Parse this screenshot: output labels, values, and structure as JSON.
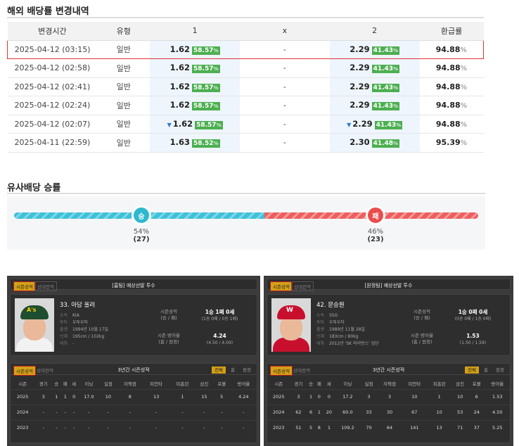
{
  "odds_section": {
    "title": "해외 배당률 변경내역",
    "headers": [
      "변경시간",
      "유형",
      "1",
      "x",
      "2",
      "환급률"
    ],
    "rows": [
      {
        "time": "2025-04-12 (03:15)",
        "type": "일반",
        "home": "1.62",
        "home_pct": "58.57",
        "draw": "-",
        "away": "2.29",
        "away_pct": "41.43",
        "return": "94.88",
        "selected": true,
        "home_down": false,
        "away_down": false
      },
      {
        "time": "2025-04-12 (02:58)",
        "type": "일반",
        "home": "1.62",
        "home_pct": "58.57",
        "draw": "-",
        "away": "2.29",
        "away_pct": "41.43",
        "return": "94.88",
        "selected": false,
        "home_down": false,
        "away_down": false
      },
      {
        "time": "2025-04-12 (02:41)",
        "type": "일반",
        "home": "1.62",
        "home_pct": "58.57",
        "draw": "-",
        "away": "2.29",
        "away_pct": "41.43",
        "return": "94.88",
        "selected": false,
        "home_down": false,
        "away_down": false
      },
      {
        "time": "2025-04-12 (02:24)",
        "type": "일반",
        "home": "1.62",
        "home_pct": "58.57",
        "draw": "-",
        "away": "2.29",
        "away_pct": "41.43",
        "return": "94.88",
        "selected": false,
        "home_down": false,
        "away_down": false
      },
      {
        "time": "2025-04-12 (02:07)",
        "type": "일반",
        "home": "1.62",
        "home_pct": "58.57",
        "draw": "-",
        "away": "2.29",
        "away_pct": "41.43",
        "return": "94.88",
        "selected": false,
        "home_down": true,
        "away_down": true
      },
      {
        "time": "2025-04-11 (22:59)",
        "type": "일반",
        "home": "1.63",
        "home_pct": "58.52",
        "draw": "-",
        "away": "2.30",
        "away_pct": "41.48",
        "return": "95.39",
        "selected": false,
        "home_down": false,
        "away_down": false
      }
    ],
    "pct_unit": "%",
    "return_unit": "%"
  },
  "similar_section": {
    "title": "유사배당 승률",
    "win_label": "승",
    "loss_label": "패",
    "win_pct": "54%",
    "win_count": "(27)",
    "loss_pct": "46%",
    "loss_count": "(23)",
    "win_fraction": 0.54,
    "colors": {
      "win": "#2db8cf",
      "loss": "#ea4d4d"
    }
  },
  "pitchers": [
    {
      "tab_active": "시즌성적",
      "tab_inactive": "상대전적",
      "header_title": "[홈팀] 예상선발 투수",
      "name": "33. 아담 올러",
      "info": [
        {
          "k": "소속",
          "v": "KIA"
        },
        {
          "k": "투타",
          "v": "우투우타"
        },
        {
          "k": "출생",
          "v": "1994년 10월 17일"
        },
        {
          "k": "신체",
          "v": "195cm / 102kg"
        },
        {
          "k": "데뷔",
          "v": "-"
        }
      ],
      "season_label_1": "시즌성적",
      "season_label_2": "(승 / 패)",
      "season_value": "1승 1패 0세",
      "season_sub": "(1승 0패 / 0승 1패)",
      "era_label_1": "시즌 방어율",
      "era_label_2": "(홈 / 원정)",
      "era_value": "4.24",
      "era_sub": "(4.50 / 4.09)",
      "stats_title": "3년간 시즌성적",
      "filters": [
        "전체",
        "홈",
        "원정"
      ],
      "tab2_active": "시즌성적",
      "tab2_inactive": "상대전적",
      "columns": [
        "시즌",
        "경기",
        "승",
        "패",
        "세",
        "이닝",
        "실점",
        "자책점",
        "피안타",
        "피홈런",
        "삼진",
        "포볼",
        "방어율"
      ],
      "rows": [
        [
          "2025",
          "3",
          "1",
          "1",
          "0",
          "17.0",
          "10",
          "8",
          "13",
          "1",
          "15",
          "5",
          "4.24"
        ],
        [
          "2024",
          "-",
          "-",
          "-",
          "-",
          "-",
          "-",
          "-",
          "-",
          "-",
          "-",
          "-",
          "-"
        ],
        [
          "2023",
          "-",
          "-",
          "-",
          "-",
          "-",
          "-",
          "-",
          "-",
          "-",
          "-",
          "-",
          "-"
        ]
      ],
      "team_logo": "A's",
      "colors": {
        "cap": "#1f4d2f",
        "body": "#f2f2f2"
      }
    },
    {
      "tab_active": "시즌성적",
      "tab_inactive": "상대전적",
      "header_title": "[원정팀] 예상선발 투수",
      "name": "42. 문승원",
      "info": [
        {
          "k": "소속",
          "v": "SSG"
        },
        {
          "k": "투타",
          "v": "우투우타"
        },
        {
          "k": "출생",
          "v": "1989년 11월 28일"
        },
        {
          "k": "신체",
          "v": "183cm / 80kg"
        },
        {
          "k": "데뷔",
          "v": "2012년 'SK 와이번스' 입단"
        }
      ],
      "season_label_1": "시즌성적",
      "season_label_2": "(승 / 패)",
      "season_value": "1승 0패 0세",
      "season_sub": "(0승 0패 / 1승 0패)",
      "era_label_1": "시즌 방어율",
      "era_label_2": "(홈 / 원정)",
      "era_value": "1.53",
      "era_sub": "(1.50 / 1.59)",
      "stats_title": "3년간 시즌성적",
      "filters": [
        "전체",
        "홈",
        "원정"
      ],
      "tab2_active": "시즌성적",
      "tab2_inactive": "상대전적",
      "columns": [
        "시즌",
        "경기",
        "승",
        "패",
        "세",
        "이닝",
        "실점",
        "자책점",
        "피안타",
        "피홈런",
        "삼진",
        "포볼",
        "방어율"
      ],
      "rows": [
        [
          "2025",
          "3",
          "1",
          "0",
          "0",
          "17.2",
          "3",
          "3",
          "10",
          "1",
          "10",
          "6",
          "1.53"
        ],
        [
          "2024",
          "62",
          "6",
          "1",
          "20",
          "60.0",
          "33",
          "30",
          "67",
          "10",
          "53",
          "24",
          "4.50"
        ],
        [
          "2023",
          "51",
          "5",
          "8",
          "1",
          "109.2",
          "70",
          "64",
          "141",
          "13",
          "71",
          "37",
          "5.25"
        ]
      ],
      "team_logo": "W",
      "colors": {
        "cap": "#c8102e",
        "body": "#c8102e"
      }
    }
  ]
}
